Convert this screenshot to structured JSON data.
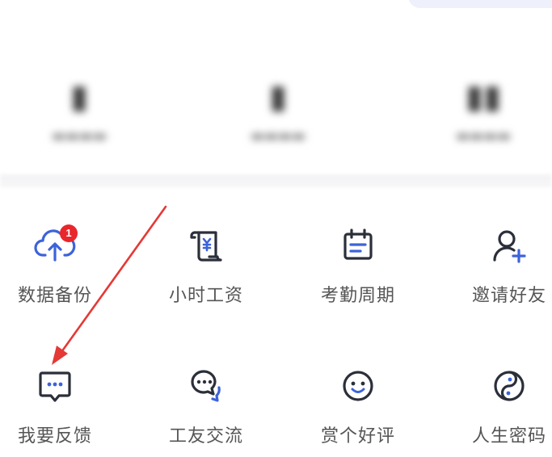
{
  "colors": {
    "accent_blue": "#3d63d9",
    "icon_dark": "#2b2f3a",
    "badge_red": "#e8262b",
    "annotation_red": "#e53935",
    "label_gray": "#555555"
  },
  "grid": {
    "row1": [
      {
        "label": "数据备份",
        "icon": "cloud-upload-icon",
        "badge": "1"
      },
      {
        "label": "小时工资",
        "icon": "scroll-yen-icon"
      },
      {
        "label": "考勤周期",
        "icon": "calendar-icon"
      },
      {
        "label": "邀请好友",
        "icon": "add-user-icon"
      }
    ],
    "row2": [
      {
        "label": "我要反馈",
        "icon": "chat-feedback-icon"
      },
      {
        "label": "工友交流",
        "icon": "chat-bubbles-icon"
      },
      {
        "label": "赏个好评",
        "icon": "smile-icon"
      },
      {
        "label": "人生密码",
        "icon": "yin-yang-icon"
      }
    ]
  }
}
